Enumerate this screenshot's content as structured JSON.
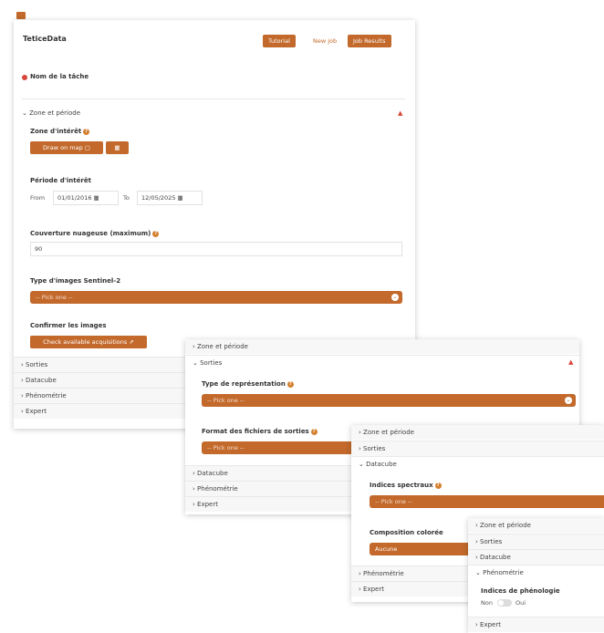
{
  "colors": {
    "accent": "#c2692b",
    "required": "#d9453a",
    "panel_bg": "#ffffff"
  },
  "panel1": {
    "app_title": "TeticeData",
    "buttons": {
      "tutorial": "Tutorial",
      "new_job": "New job",
      "job_results": "Job Results"
    },
    "task_name_label": "Nom de la tâche",
    "zone_header": "Zone et période",
    "zone_interet_label": "Zone d'intérêt",
    "draw_on_map": "Draw on map",
    "periode_label": "Période d'intérêt",
    "from_label": "From",
    "from_date": "01/01/2016",
    "to_label": "To",
    "to_date": "12/05/2025",
    "couverture_label": "Couverture nuageuse (maximum)",
    "couverture_value": "90",
    "type_images_label": "Type d'images Sentinel-2",
    "pick_one": "-- Pick one --",
    "confirmer_label": "Confirmer les images",
    "check_button": "Check available acquisitions",
    "sections": [
      "Sorties",
      "Datacube",
      "Phénométrie",
      "Expert"
    ]
  },
  "panel2": {
    "zone_header": "Zone et période",
    "sorties_header": "Sorties",
    "type_representation_label": "Type de représentation",
    "pick_one": "-- Pick one --",
    "format_label": "Format des fichiers de sorties",
    "pick_one_2": "-- Pick one --",
    "sections": [
      "Datacube",
      "Phénométrie",
      "Expert"
    ]
  },
  "panel3": {
    "zone_header": "Zone et période",
    "sorties_header": "Sorties",
    "datacube_header": "Datacube",
    "indices_label": "Indices spectraux",
    "pick_one": "-- Pick one --",
    "composition_label": "Composition colorée",
    "composition_value": "Aucune",
    "sections": [
      "Phénométrie",
      "Expert"
    ]
  },
  "panel4": {
    "zone_header": "Zone et période",
    "sorties_header": "Sorties",
    "datacube_header": "Datacube",
    "phenometrie_header": "Phénométrie",
    "indices_label": "Indices de phénologie",
    "toggle_off": "Non",
    "toggle_on": "Oui",
    "expert_header": "Expert"
  }
}
